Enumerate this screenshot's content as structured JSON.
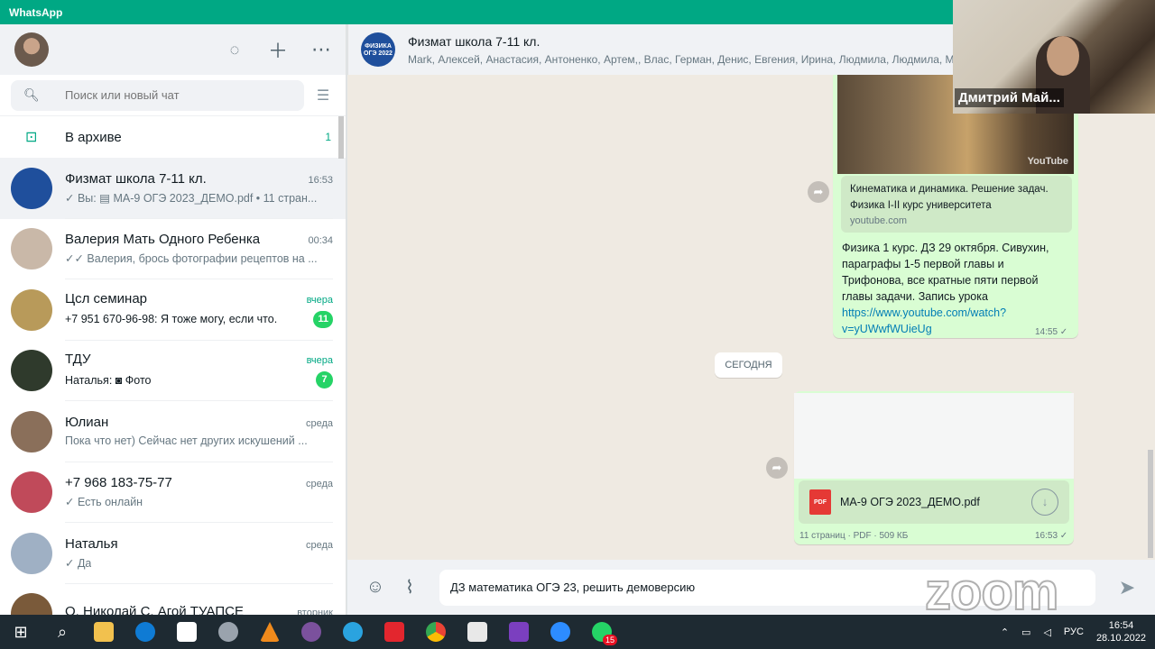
{
  "app_title": "WhatsApp",
  "sidebar": {
    "search_placeholder": "Поиск или новый чат",
    "archive": {
      "label": "В архиве",
      "count": "1"
    },
    "chats": [
      {
        "name": "Физмат школа 7-11 кл.",
        "time": "16:53",
        "preview": "✓ Вы: ▤ МА-9 ОГЭ 2023_ДЕМО.pdf • 11 стран...",
        "active": true,
        "avatar_color": "#1f4f9c"
      },
      {
        "name": "Валерия Мать Одного Ребенка",
        "time": "00:34",
        "preview": "✓✓ Валерия, брось фотографии рецептов на ...",
        "avatar_color": "#c9b8a8"
      },
      {
        "name": "Цсл семинар",
        "time": "вчера",
        "preview": "+7 951 670-96-98: Я тоже могу, если что.",
        "unread": "11",
        "avatar_color": "#b89a5a"
      },
      {
        "name": "ТДУ",
        "time": "вчера",
        "preview": "Наталья: ◙ Фото",
        "unread": "7",
        "avatar_color": "#2f3a2c"
      },
      {
        "name": "Юлиан",
        "time": "среда",
        "preview": "Пока что нет) Сейчас нет других искушений ...",
        "avatar_color": "#8a6f5a"
      },
      {
        "name": "+7 968 183-75-77",
        "time": "среда",
        "preview": "✓ Есть онлайн",
        "avatar_color": "#c04a5a"
      },
      {
        "name": "Наталья",
        "time": "среда",
        "preview": "✓ Да",
        "avatar_color": "#9fb0c4"
      },
      {
        "name": "О. Николай С. Агой ТУАПСЕ",
        "time": "вторник",
        "preview": "",
        "avatar_color": "#7a5a3a"
      }
    ]
  },
  "chat": {
    "title": "Физмат школа 7-11 кл.",
    "members": "Mark, Алексей, Анастасия, Антоненко, Артем,, Влас, Герман, Денис, Евгения, Ирина, Людмила, Людмила, Ма",
    "avatar_text": "ФИЗИКА ОГЭ 2022",
    "video_badge": "YouTube",
    "link_preview": {
      "title": "Кинематика и динамика. Решение задач. Физика I-II курс университета",
      "domain": "youtube.com"
    },
    "message_text": "Физика 1 курс. ДЗ 29 октября. Сивухин, параграфы 1-5 первой главы и Трифонова, все кратные пяти первой главы задачи. Запись урока",
    "message_link": "https://www.youtube.com/watch?v=yUWwfWUieUg",
    "message_time": "14:55 ✓",
    "date_chip": "СЕГОДНЯ",
    "document": {
      "name": "МА-9 ОГЭ 2023_ДЕМО.pdf",
      "icon_label": "PDF",
      "info": "11 страниц · PDF · 509 КБ",
      "time": "16:53 ✓"
    },
    "composer_text": "ДЗ математика ОГЭ 23, решить демоверсию"
  },
  "zoom_watermark": "zoom",
  "video_overlay": {
    "name": "Дмитрий Май..."
  },
  "taskbar": {
    "lang": "РУС",
    "time": "16:54",
    "date": "28.10.2022",
    "whatsapp_badge": "15"
  }
}
